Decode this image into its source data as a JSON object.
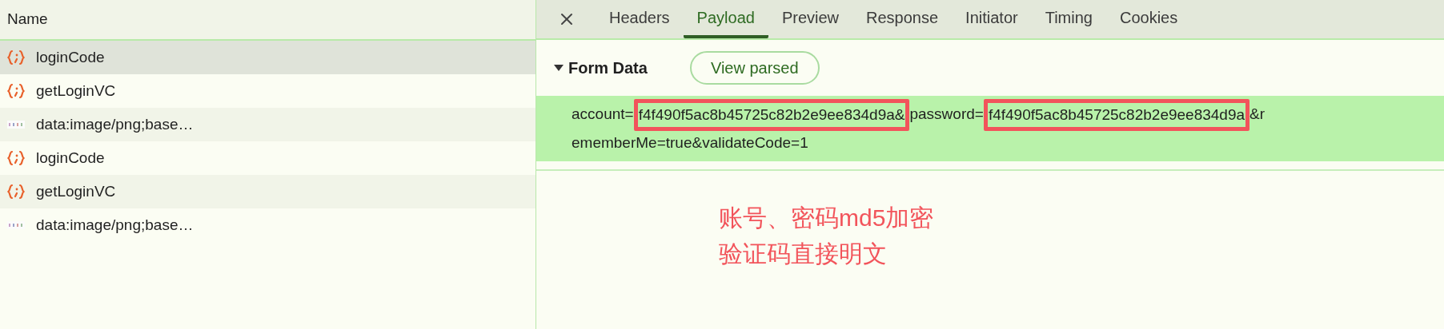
{
  "request_list": {
    "header": "Name",
    "rows": [
      {
        "kind": "script",
        "name": "loginCode",
        "selected": true
      },
      {
        "kind": "script",
        "name": "getLoginVC",
        "selected": false
      },
      {
        "name": "data:image/png;base…",
        "selected": false
      },
      {
        "kind": "script",
        "name": "loginCode",
        "selected": false
      },
      {
        "kind": "script",
        "name": "getLoginVC",
        "selected": false
      },
      {
        "name": "data:image/png;base…",
        "selected": false
      }
    ]
  },
  "tabs": [
    {
      "label": "Headers",
      "selected": false
    },
    {
      "label": "Payload",
      "selected": true
    },
    {
      "label": "Preview",
      "selected": false
    },
    {
      "label": "Response",
      "selected": false
    },
    {
      "label": "Initiator",
      "selected": false
    },
    {
      "label": "Timing",
      "selected": false
    },
    {
      "label": "Cookies",
      "selected": false
    }
  ],
  "form_data": {
    "title": "Form Data",
    "expanded": true,
    "button": "View parsed",
    "lines": [
      [
        {
          "text": "account=",
          "highlighted": false
        },
        {
          "text": "f4f490f5ac8b45725c82b2e9ee834d9a&",
          "highlighted": true
        },
        {
          "text": "password=",
          "highlighted": false
        },
        {
          "text": "f4f490f5ac8b45725c82b2e9ee834d9a",
          "highlighted": true
        },
        {
          "text": "&r",
          "highlighted": false
        }
      ],
      [
        {
          "text": "ememberMe=true&validateCode=1",
          "highlighted": false
        }
      ]
    ]
  },
  "annotation": [
    "账号、密码md5加密",
    "验证码直接明文"
  ]
}
